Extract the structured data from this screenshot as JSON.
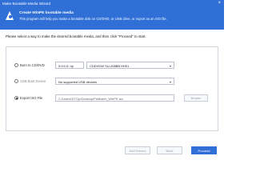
{
  "window": {
    "title": "Make Bootable Media Wizard",
    "close_glyph": "×"
  },
  "banner": {
    "heading": "Create WinPE bootable media",
    "subtitle": "This program will help you make a bootable disk on CD/DVD, or USB drive, or export as an ISO file."
  },
  "instruction": "Please select a way to make the desired bootable media, and then click \"Proceed\" to start.",
  "options": {
    "cd": {
      "label": "Burn to CD/DVD",
      "drive": "0:0:0,0: hp",
      "device": "CDDVDW SU-208BB HH01",
      "selected": false
    },
    "usb": {
      "label": "USB Boot Device",
      "value": "No supported USB devices",
      "selected": false,
      "disabled": true
    },
    "iso": {
      "label": "Export ISO File",
      "path": "C:\\Users\\DTOp\\Desktop\\PeMaker_WinPE.iso",
      "browse": "Browse",
      "selected": true
    }
  },
  "footer": {
    "add_drivers": "Add Drivers",
    "back": "Back",
    "proceed": "Proceed"
  },
  "colors": {
    "accent": "#2f6fd6"
  }
}
